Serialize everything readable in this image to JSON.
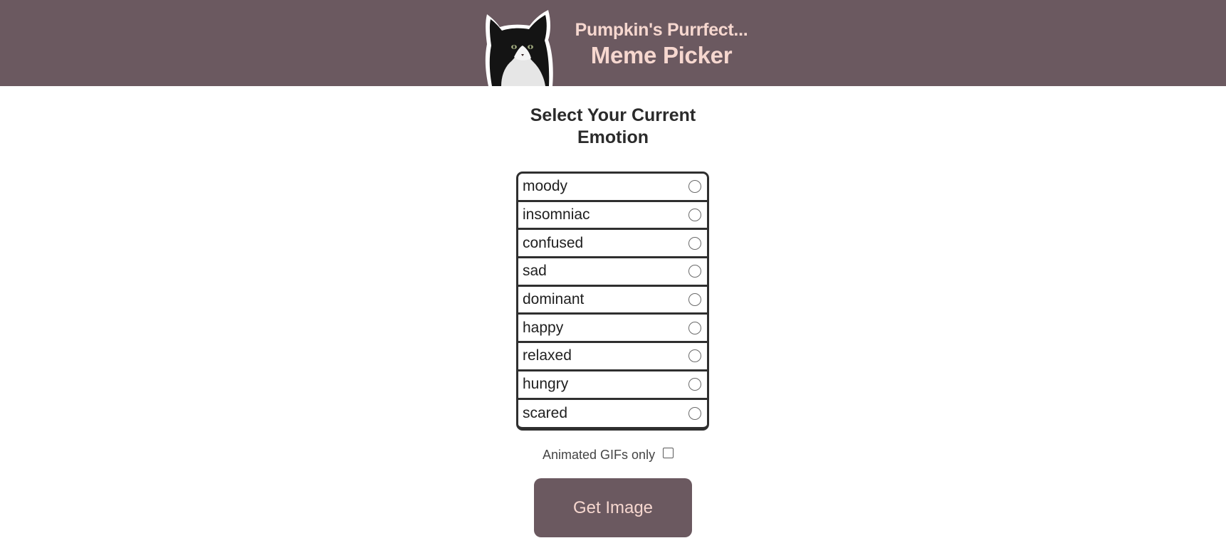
{
  "header": {
    "title_top": "Pumpkin's Purrfect...",
    "title_main": "Meme Picker",
    "logo_icon": "tuxedo-cat-photo",
    "background_color": "#6b5960",
    "title_color": "#f6d7cf"
  },
  "main": {
    "heading_line1": "Select Your Current",
    "heading_line2": "Emotion",
    "emotions": [
      {
        "label": "moody",
        "selected": false
      },
      {
        "label": "insomniac",
        "selected": false
      },
      {
        "label": "confused",
        "selected": false
      },
      {
        "label": "sad",
        "selected": false
      },
      {
        "label": "dominant",
        "selected": false
      },
      {
        "label": "happy",
        "selected": false
      },
      {
        "label": "relaxed",
        "selected": false
      },
      {
        "label": "hungry",
        "selected": false
      },
      {
        "label": "scared",
        "selected": false
      }
    ],
    "gifs_only_label": "Animated GIFs only",
    "gifs_only_checked": false,
    "get_image_label": "Get Image"
  }
}
